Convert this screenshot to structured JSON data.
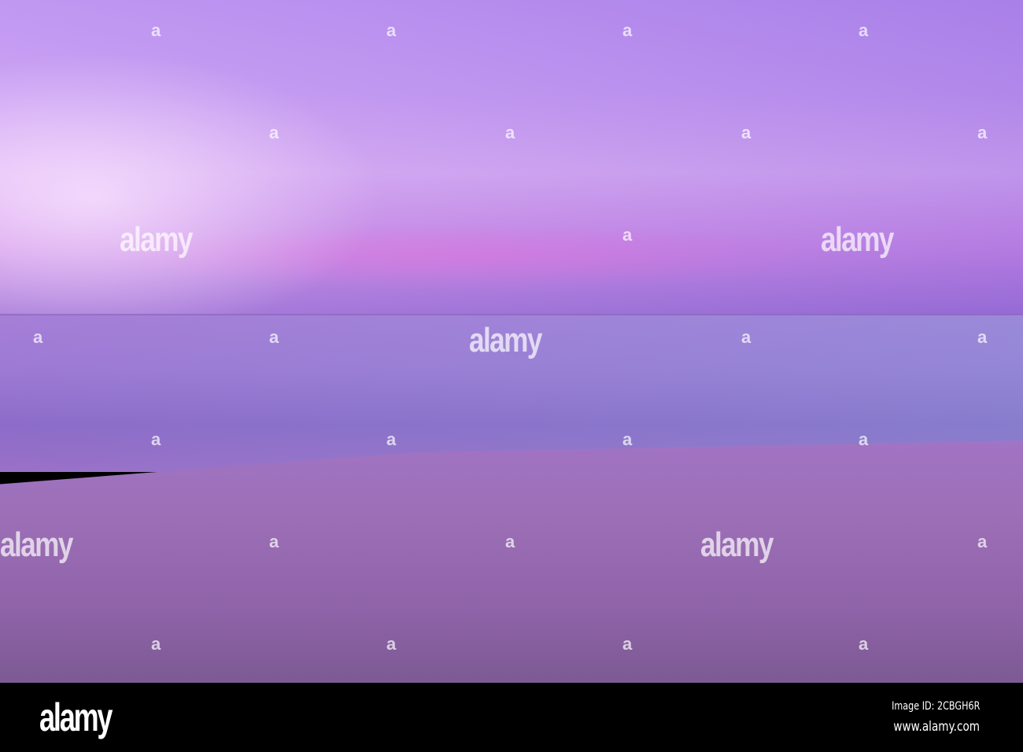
{
  "photo": {
    "subject": "sunset-beach",
    "colors": {
      "sky": "#c497f2",
      "sea": "#9d7ad4",
      "sand": "#8f63a8"
    },
    "watermark_text": "alamy",
    "watermark_mark": "a"
  },
  "footer": {
    "logo": "alamy",
    "image_id": "Image ID: 2CBGH6R",
    "url": "www.alamy.com"
  }
}
